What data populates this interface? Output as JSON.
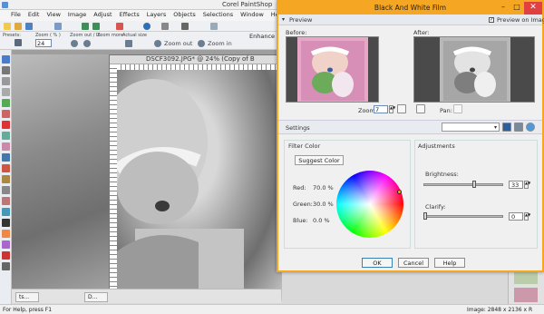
{
  "app": {
    "title": "Corel PaintShop",
    "enhance_label": "Enhance P"
  },
  "menu": [
    "File",
    "Edit",
    "View",
    "Image",
    "Adjust",
    "Effects",
    "Layers",
    "Objects",
    "Selections",
    "Window",
    "Help"
  ],
  "toolbar": {
    "presets_label": "Presets:",
    "zoom_label": "Zoom ( % )",
    "zoom_value": "24",
    "zoom_out_in_label": "Zoom out / In",
    "zoom_more_label": "Zoom more",
    "actual_size_label": "Actual size",
    "zoom_out_btn": "Zoom out",
    "zoom_in_btn": "Zoom in"
  },
  "document": {
    "title": "DSCF3092.JPG* @  24% (Copy of B"
  },
  "tabs": [
    "ts...",
    "D..."
  ],
  "status": {
    "left": "For Help, press F1",
    "right": "Image: 2848 x 2136 x R"
  },
  "dialog": {
    "title": "Black And White Film",
    "preview_header": "Preview",
    "preview_on_image": "Preview on Image",
    "before_label": "Before:",
    "after_label": "After:",
    "zoom_label": "Zoom:",
    "zoom_value": "7",
    "pan_label": "Pan:",
    "settings_label": "Settings",
    "filter_color_label": "Filter Color",
    "suggest_color_btn": "Suggest Color",
    "red_label": "Red:",
    "red_value": "70.0 %",
    "green_label": "Green:",
    "green_value": "30.0 %",
    "blue_label": "Blue:",
    "blue_value": "0.0 %",
    "adjustments_label": "Adjustments",
    "brightness_label": "Brightness:",
    "brightness_value": "33",
    "clarify_label": "Clarify:",
    "clarify_value": "0",
    "ok_btn": "OK",
    "cancel_btn": "Cancel",
    "help_btn": "Help"
  },
  "colors": {
    "accent": "#f5a623",
    "close": "#e04040",
    "wheel_marker": "#f2b000"
  }
}
